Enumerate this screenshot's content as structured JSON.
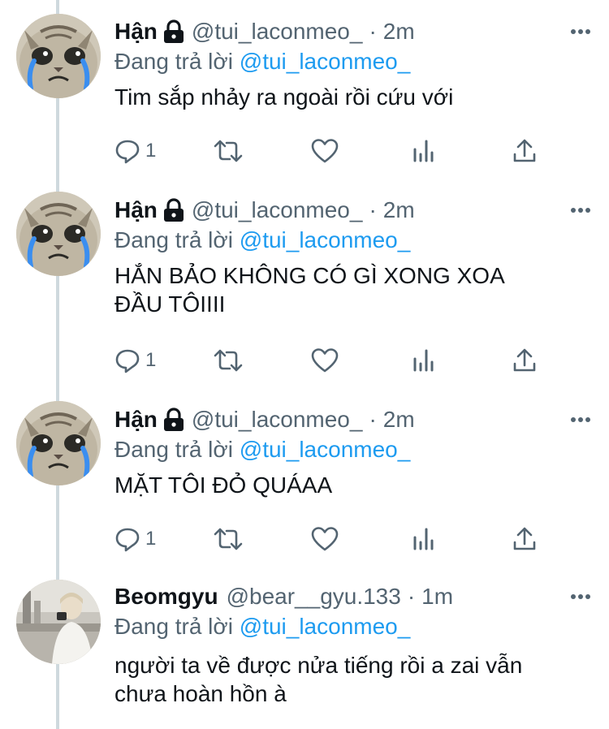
{
  "colors": {
    "accent": "#1d9bf0",
    "muted": "#536471",
    "text": "#0f1419",
    "thread_line": "#cfd9de"
  },
  "tweets": [
    {
      "name": "Hận",
      "locked": true,
      "handle": "@tui_laconmeo_",
      "dot": "·",
      "time": "2m",
      "reply_prefix": "Đang trả lời",
      "reply_handle": "@tui_laconmeo_",
      "text_lines": [
        "Tim sắp nhảy ra ngoài rồi cứu với"
      ],
      "reply_count": "1",
      "avatar": "crying-cat-avatar"
    },
    {
      "name": "Hận",
      "locked": true,
      "handle": "@tui_laconmeo_",
      "dot": "·",
      "time": "2m",
      "reply_prefix": "Đang trả lời",
      "reply_handle": "@tui_laconmeo_",
      "text_lines": [
        "HẮN BẢO KHÔNG CÓ GÌ XONG XOA",
        "ĐẦU TÔIIII"
      ],
      "reply_count": "1",
      "avatar": "crying-cat-avatar"
    },
    {
      "name": "Hận",
      "locked": true,
      "handle": "@tui_laconmeo_",
      "dot": "·",
      "time": "2m",
      "reply_prefix": "Đang trả lời",
      "reply_handle": "@tui_laconmeo_",
      "text_lines": [
        "MẶT TÔI ĐỎ QUÁAA"
      ],
      "reply_count": "1",
      "avatar": "crying-cat-avatar"
    },
    {
      "name": "Beomgyu",
      "locked": false,
      "handle": "@bear__gyu.133",
      "dot": "·",
      "time": "1m",
      "reply_prefix": "Đang trả lời",
      "reply_handle": "@tui_laconmeo_",
      "text_lines": [
        "người ta về được nửa tiếng rồi a zai vẫn",
        "chưa hoàn hồn à"
      ],
      "avatar": "person-photo-avatar"
    }
  ]
}
